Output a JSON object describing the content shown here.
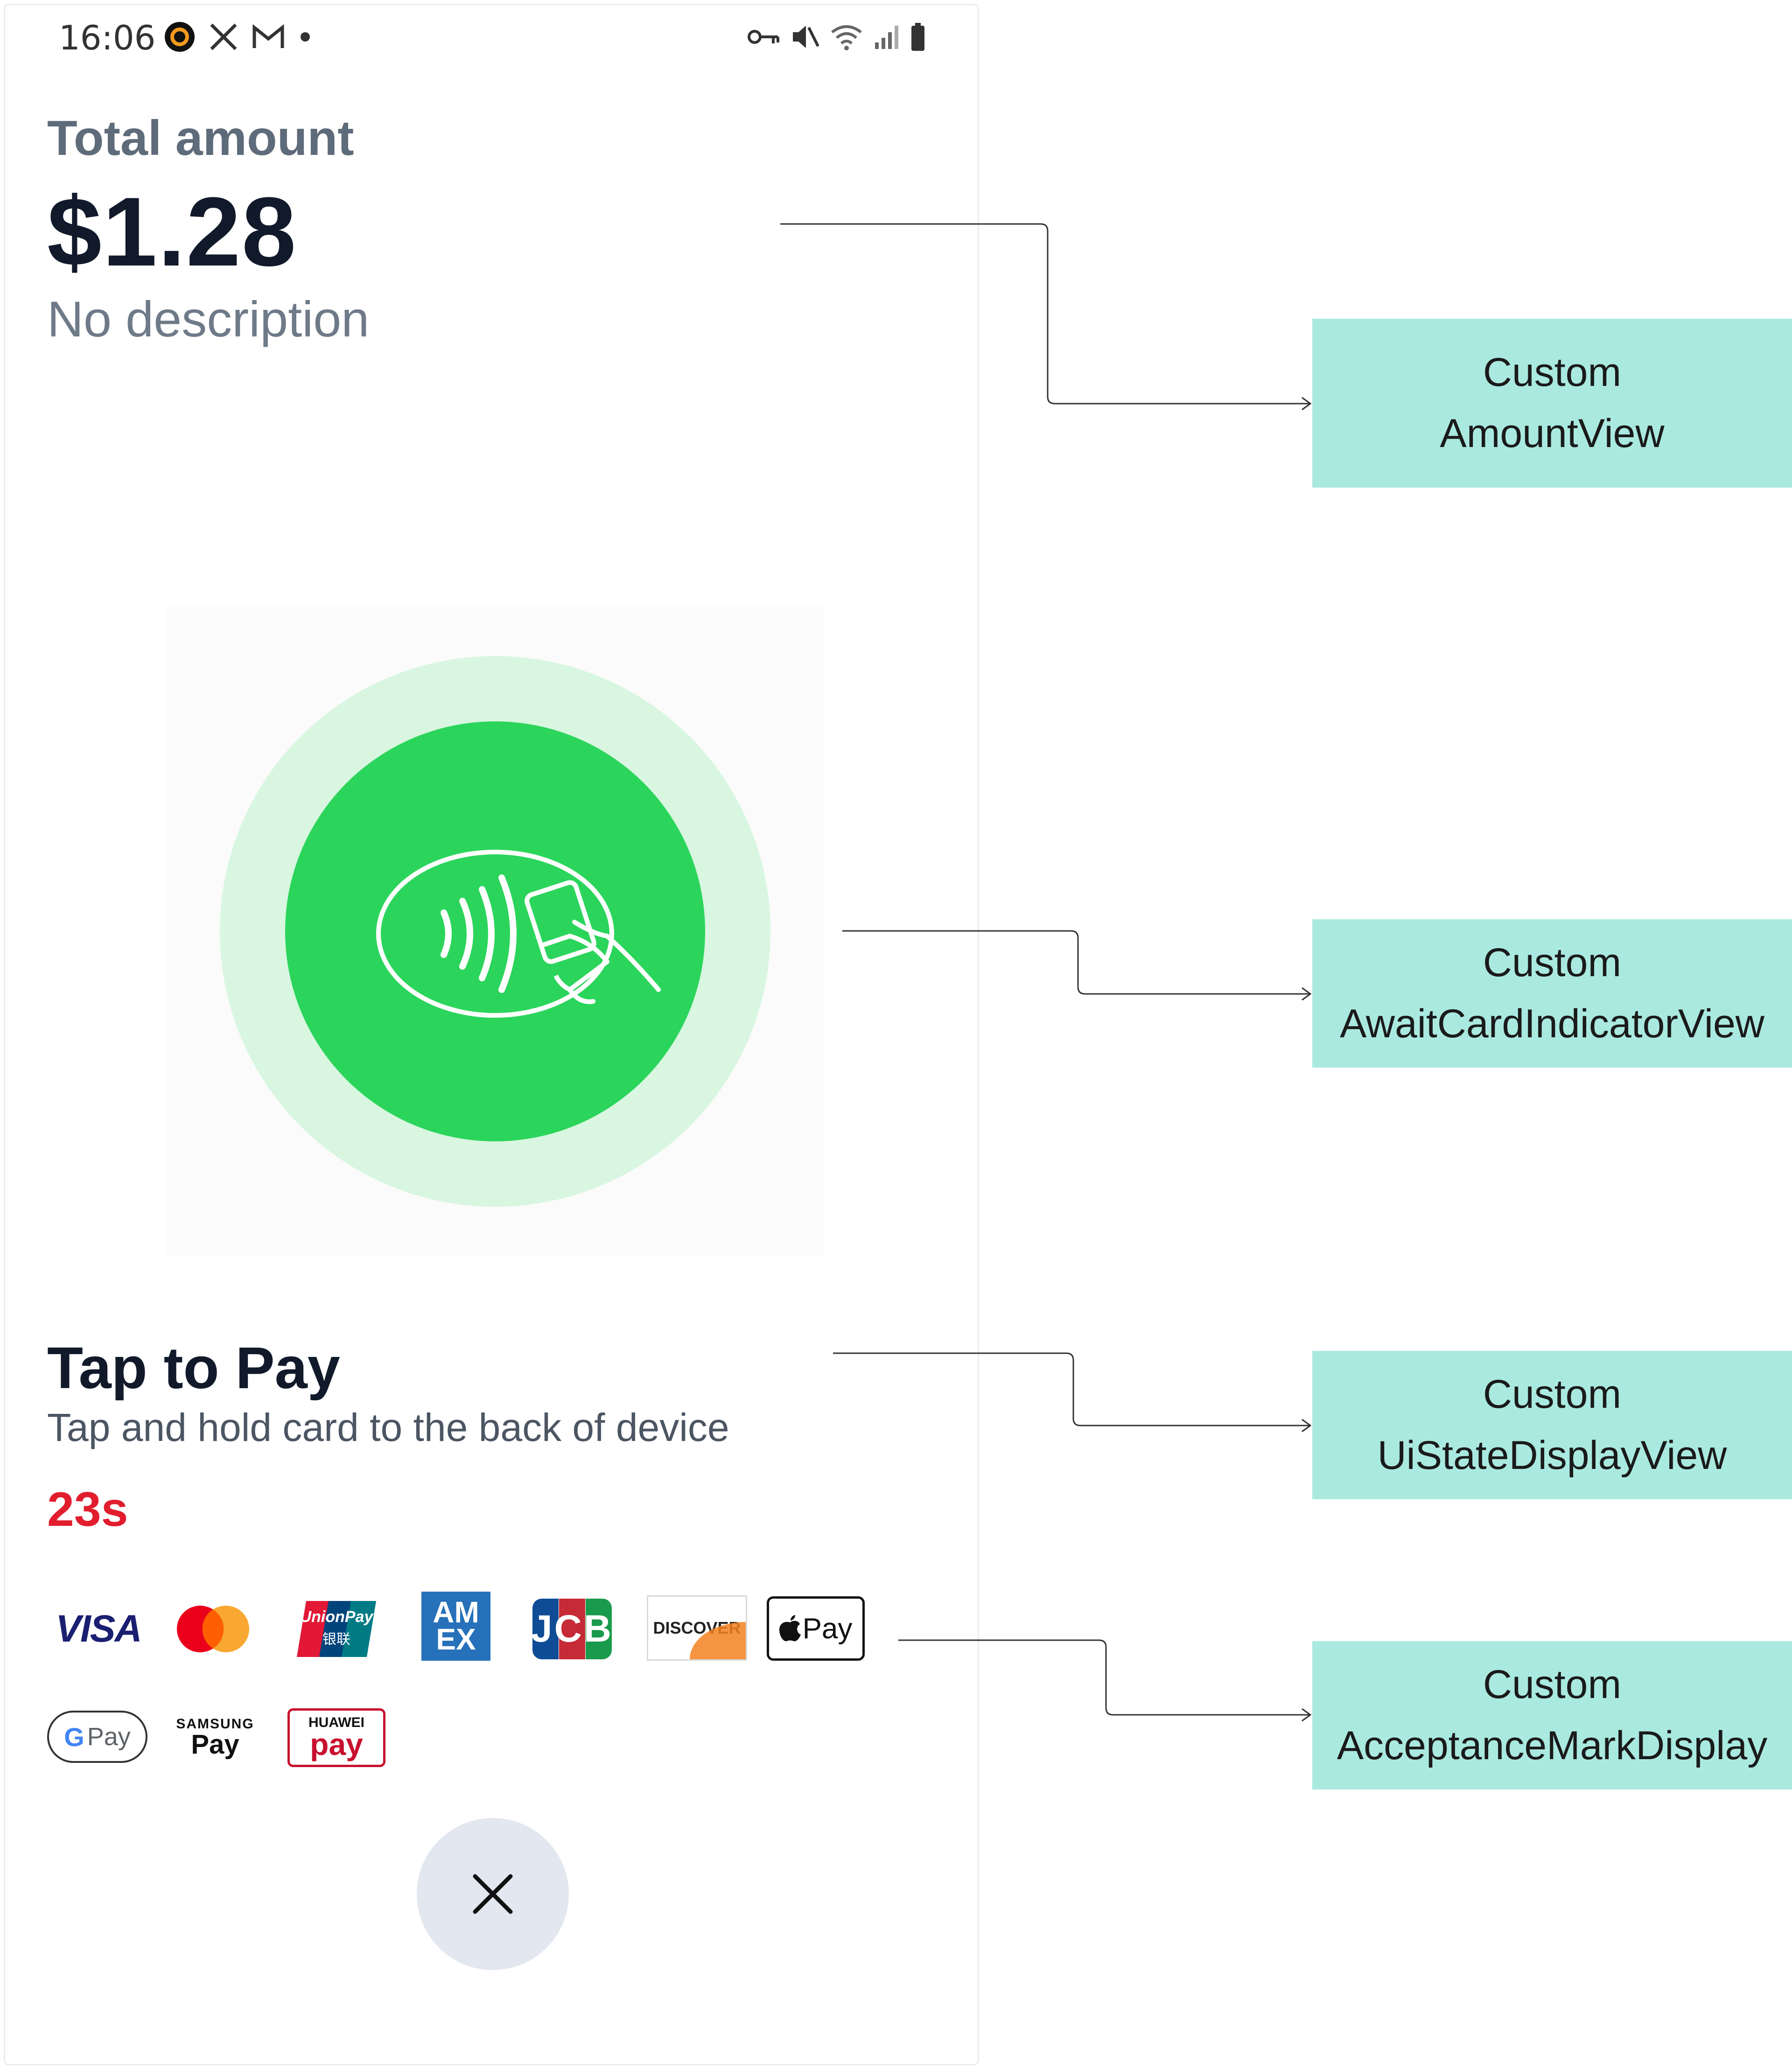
{
  "status_bar": {
    "time": "16:06"
  },
  "amount_view": {
    "label": "Total amount",
    "amount": "$1.28",
    "description": "No description"
  },
  "ui_state": {
    "title": "Tap to Pay",
    "subtitle": "Tap and hold card to the back of device",
    "countdown": "23s"
  },
  "acceptance_marks": {
    "visa": "VISA",
    "unionpay": "UnionPay",
    "unionpay_cn": "银联",
    "amex_top": "AM",
    "amex_bottom": "EX",
    "jcb": "JCB",
    "discover": "DISCOVER",
    "apple_pay": "Pay",
    "google_pay": "Pay",
    "samsung_pay_top": "SAMSUNG",
    "samsung_pay_bottom": "Pay",
    "huawei_pay_top": "HUAWEI",
    "huawei_pay_bottom": "pay"
  },
  "callouts": [
    {
      "line1": "Custom",
      "line2": "AmountView"
    },
    {
      "line1": "Custom",
      "line2": "AwaitCardIndicatorView"
    },
    {
      "line1": "Custom",
      "line2": "UiStateDisplayView"
    },
    {
      "line1": "Custom",
      "line2": "AcceptanceMarkDisplay"
    }
  ],
  "colors": {
    "accent_green": "#2bd55b",
    "accent_green_light": "#d8f6e0",
    "timer_red": "#e11d2e",
    "callout_bg": "#aae9e0"
  },
  "icons": {
    "close": "close-icon",
    "contactless": "contactless-card-icon"
  }
}
